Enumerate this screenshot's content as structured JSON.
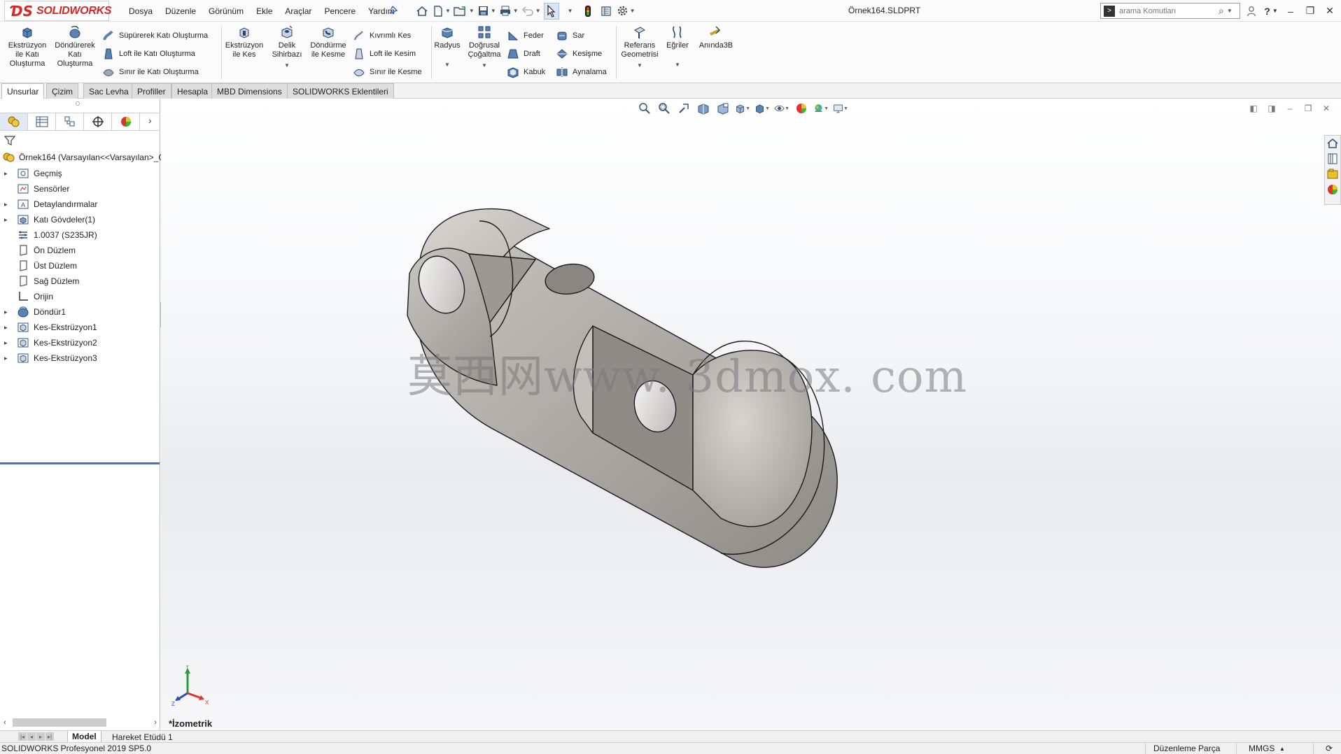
{
  "app": {
    "brand": "SOLIDWORKS",
    "document_title": "Örnek164.SLDPRT"
  },
  "menu": [
    "Dosya",
    "Düzenle",
    "Görünüm",
    "Ekle",
    "Araçlar",
    "Pencere",
    "Yardım"
  ],
  "search": {
    "placeholder": "arama Komutları"
  },
  "ribbon": {
    "extrude_boss": "Ekstrüzyon ile Katı Oluşturma",
    "revolve_boss": "Döndürerek Katı Oluşturma",
    "swept_boss": "Süpürerek Katı Oluşturma",
    "loft_boss": "Loft ile Katı Oluşturma",
    "boundary_boss": "Sınır ile Katı Oluşturma",
    "extrude_cut": "Ekstrüzyon ile Kes",
    "hole_wizard": "Delik Sihirbazı",
    "revolve_cut": "Döndürme ile Kesme",
    "swept_cut": "Kıvrımlı Kes",
    "loft_cut": "Loft ile Kesim",
    "boundary_cut": "Sınır ile Kesme",
    "fillet": "Radyus",
    "linear_pattern": "Doğrusal Çoğaltma",
    "rib": "Feder",
    "draft": "Draft",
    "shell": "Kabuk",
    "wrap": "Sar",
    "intersect": "Kesişme",
    "mirror": "Aynalama",
    "ref_geometry": "Referans Geometrisi",
    "curves": "Eğriler",
    "instant3d": "Anında3B"
  },
  "tabs": [
    "Unsurlar",
    "Çizim",
    "Sac Levha",
    "Profiller",
    "Hesapla",
    "MBD Dimensions",
    "SOLIDWORKS Eklentileri"
  ],
  "tree": {
    "root": "Örnek164  (Varsayılan<<Varsayılan>_G",
    "items": [
      {
        "label": "Geçmiş",
        "expandable": true,
        "icon": "history-icon"
      },
      {
        "label": "Sensörler",
        "expandable": false,
        "icon": "sensor-icon"
      },
      {
        "label": "Detaylandırmalar",
        "expandable": true,
        "icon": "annotations-icon"
      },
      {
        "label": "Katı Gövdeler(1)",
        "expandable": true,
        "icon": "solid-bodies-icon"
      },
      {
        "label": "1.0037 (S235JR)",
        "expandable": false,
        "icon": "material-icon"
      },
      {
        "label": "Ön Düzlem",
        "expandable": false,
        "icon": "plane-icon"
      },
      {
        "label": "Üst Düzlem",
        "expandable": false,
        "icon": "plane-icon"
      },
      {
        "label": "Sağ Düzlem",
        "expandable": false,
        "icon": "plane-icon"
      },
      {
        "label": "Orijin",
        "expandable": false,
        "icon": "origin-icon"
      },
      {
        "label": "Döndür1",
        "expandable": true,
        "icon": "revolve-icon"
      },
      {
        "label": "Kes-Ekstrüzyon1",
        "expandable": true,
        "icon": "cut-extrude-icon"
      },
      {
        "label": "Kes-Ekstrüzyon2",
        "expandable": true,
        "icon": "cut-extrude-icon"
      },
      {
        "label": "Kes-Ekstrüzyon3",
        "expandable": true,
        "icon": "cut-extrude-icon"
      }
    ]
  },
  "viewport": {
    "watermark": "莫西网www. 3dmox. com",
    "view_name": "*İzometrik"
  },
  "bottom_tabs": [
    "Model",
    "Hareket Etüdü 1"
  ],
  "status": {
    "version": "SOLIDWORKS Profesyonel 2019 SP5.0",
    "mode": "Düzenleme Parça",
    "units": "MMGS"
  },
  "colors": {
    "brand_red": "#d62826",
    "accent_blue": "#3a7bbf",
    "part_gray": "#a9a7a4"
  }
}
